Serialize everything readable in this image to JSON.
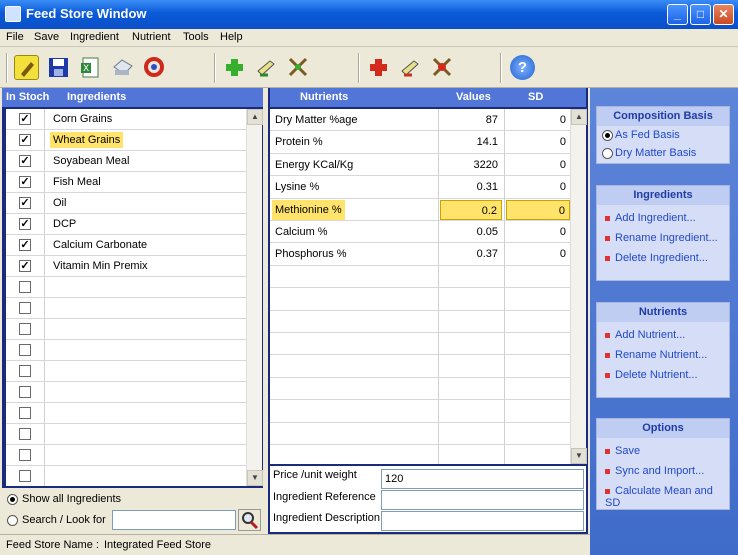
{
  "window": {
    "title": "Feed Store Window",
    "min": "_",
    "max": "□",
    "close": "✕"
  },
  "menu": [
    "File",
    "Save",
    "Ingredient",
    "Nutrient",
    "Tools",
    "Help"
  ],
  "toolbar": {
    "icons": [
      "edit-icon",
      "save-icon",
      "excel-export-icon",
      "print-icon",
      "refresh-icon",
      "add-ingredient-icon",
      "edit-ingredient-icon",
      "tools-ingredient-icon",
      "remove-ingredient-icon",
      "edit-nutrient-icon",
      "tools-nutrient-icon",
      "help-icon"
    ]
  },
  "ingredients": {
    "headers": {
      "stock": "In Stoch",
      "name": "Ingredients"
    },
    "rows": [
      {
        "checked": true,
        "name": "Corn Grains"
      },
      {
        "checked": true,
        "name": "Wheat Grains",
        "selected": true
      },
      {
        "checked": true,
        "name": "Soyabean Meal"
      },
      {
        "checked": true,
        "name": "Fish Meal"
      },
      {
        "checked": true,
        "name": "Oil"
      },
      {
        "checked": true,
        "name": "DCP"
      },
      {
        "checked": true,
        "name": "Calcium Carbonate"
      },
      {
        "checked": true,
        "name": "Vitamin Min Premix"
      },
      {
        "checked": false,
        "name": ""
      },
      {
        "checked": false,
        "name": ""
      },
      {
        "checked": false,
        "name": ""
      },
      {
        "checked": false,
        "name": ""
      },
      {
        "checked": false,
        "name": ""
      },
      {
        "checked": false,
        "name": ""
      },
      {
        "checked": false,
        "name": ""
      },
      {
        "checked": false,
        "name": ""
      },
      {
        "checked": false,
        "name": ""
      },
      {
        "checked": false,
        "name": ""
      }
    ]
  },
  "filters": {
    "show_all": "Show all Ingredients",
    "search": "Search / Look for",
    "search_value": ""
  },
  "nutrients": {
    "headers": {
      "name": "Nutrients",
      "value": "Values",
      "sd": "SD"
    },
    "rows": [
      {
        "name": "Dry Matter %age",
        "value": "87",
        "sd": "0"
      },
      {
        "name": "Protein %",
        "value": "14.1",
        "sd": "0"
      },
      {
        "name": "Energy KCal/Kg",
        "value": "3220",
        "sd": "0"
      },
      {
        "name": "Lysine %",
        "value": "0.31",
        "sd": "0"
      },
      {
        "name": "Methionine %",
        "value": "0.2",
        "sd": "0",
        "selected": true
      },
      {
        "name": "Calcium %",
        "value": "0.05",
        "sd": "0"
      },
      {
        "name": "Phosphorus %",
        "value": "0.37",
        "sd": "0"
      }
    ],
    "empty_rows": 9
  },
  "details": {
    "price_label": "Price  /unit weight",
    "price_value": "120",
    "ref_label": "Ingredient Reference",
    "ref_value": "",
    "desc_label": "Ingredient Description",
    "desc_value": ""
  },
  "status": {
    "label": "Feed Store Name :",
    "value": "Integrated Feed Store"
  },
  "side": {
    "composition": {
      "title": "Composition Basis",
      "options": [
        "As Fed Basis",
        "Dry Matter Basis"
      ],
      "selected": 0
    },
    "ingredients": {
      "title": "Ingredients",
      "links": [
        "Add Ingredient...",
        "Rename Ingredient...",
        "Delete Ingredient..."
      ]
    },
    "nutrients": {
      "title": "Nutrients",
      "links": [
        "Add Nutrient...",
        "Rename Nutrient...",
        "Delete Nutrient..."
      ]
    },
    "options": {
      "title": "Options",
      "links": [
        "Save",
        "Sync and Import...",
        "Calculate Mean and SD"
      ]
    }
  },
  "colors": {
    "highlight": "#ffe36a",
    "panel_blue": "#1a2a7c",
    "header_blue": "#5276d8",
    "link": "#2148c9"
  }
}
